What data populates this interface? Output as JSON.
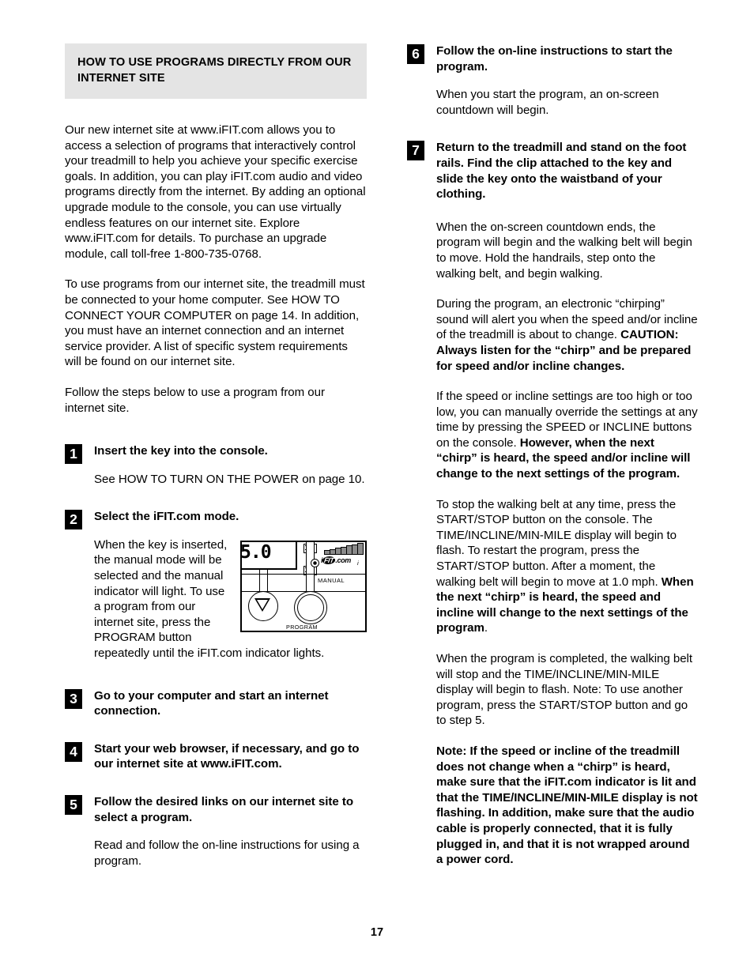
{
  "page": {
    "number": "17"
  },
  "section": {
    "heading": "HOW TO USE PROGRAMS DIRECTLY FROM OUR INTERNET SITE"
  },
  "left_column": {
    "intro_paragraphs": [
      "Our new internet site at www.iFIT.com allows you to access a selection of programs that interactively control your treadmill to help you achieve your specific exercise goals. In addition, you can play iFIT.com audio and video programs directly from the internet. By adding an optional upgrade module to the console, you can use virtually endless features on our internet site. Explore www.iFIT.com for details. To purchase an upgrade module, call toll-free 1-800-735-0768.",
      "To use programs from our internet site, the treadmill must be connected to your home computer. See HOW TO CONNECT YOUR COMPUTER on page 14. In addition, you must have an internet connection and an internet service provider. A list of specific system requirements will be found on our internet site.",
      "Follow the steps below to use a program from our internet site."
    ],
    "steps": [
      {
        "number": "1",
        "title": "Insert the key into the console.",
        "body": "See HOW TO TURN ON THE POWER on page 10."
      },
      {
        "number": "2",
        "title": "Select the iFIT.com mode.",
        "body": "When the key is inserted, the manual mode will be selected and the manual indicator will light. To use a program from our internet site, press the PROGRAM button repeatedly until the iFIT.com indicator lights."
      },
      {
        "number": "3",
        "title": "Go to your computer and start an internet connection.",
        "body": ""
      },
      {
        "number": "4",
        "title": "Start your web browser, if necessary, and go to our internet site at www.iFIT.com.",
        "body": ""
      },
      {
        "number": "5",
        "title": "Follow the desired links on our internet site to select a program.",
        "body": "Read and follow the on-line instructions for using a program."
      }
    ],
    "console_figure": {
      "display_value": "5.0",
      "manual_label": "MANUAL",
      "program_label": "PROGRAM",
      "ifit_logo": "iFIT.com",
      "indicator_label": "i"
    }
  },
  "right_column": {
    "steps": [
      {
        "number": "6",
        "title": "Follow the on-line instructions to start the program.",
        "body": "When you start the program, an on-screen countdown will begin."
      },
      {
        "number": "7",
        "title": "Return to the treadmill and stand on the foot rails. Find the clip attached to the key and slide the key onto the waistband of your clothing.",
        "body": ""
      }
    ],
    "paragraphs": [
      {
        "normal_1": "When the on-screen countdown ends, the program will begin and the walking belt will begin to move. Hold the handrails, step onto the walking belt, and begin walking.",
        "bold_1": "",
        "normal_2": ""
      },
      {
        "normal_1": "During the program, an electronic “chirping” sound will alert you when the speed and/or incline of the treadmill is about to change. ",
        "bold_1": "CAUTION: Always listen for the “chirp” and be prepared for speed and/or incline changes.",
        "normal_2": ""
      },
      {
        "normal_1": "If the speed or incline settings are too high or too low, you can manually override the settings at any time by pressing the SPEED or INCLINE buttons on the console. ",
        "bold_1": "However, when the next “chirp” is heard, the speed and/or incline will change to the next settings of the program.",
        "normal_2": ""
      },
      {
        "normal_1": "To stop the walking belt at any time, press the START/STOP button on the console. The TIME/INCLINE/MIN-MILE display will begin to flash. To restart the program, press the START/STOP button. After a moment, the walking belt will begin to move at 1.0 mph. ",
        "bold_1": "When the next “chirp” is heard, the speed and incline will change to the next settings of the program",
        "normal_2": "."
      },
      {
        "normal_1": "When the program is completed, the walking belt will stop and the TIME/INCLINE/MIN-MILE display will begin to flash. Note: To use another program, press the START/STOP button and go to step 5.",
        "bold_1": "",
        "normal_2": ""
      },
      {
        "normal_1": "",
        "bold_1": "Note: If the speed or incline of the treadmill does not change when a “chirp” is heard, make sure that the iFIT.com indicator is lit and that the TIME/INCLINE/MIN-MILE display is not flashing. In addition, make sure that the audio cable is properly connected, that it is fully plugged in, and that it is not wrapped around a power cord.",
        "normal_2": ""
      }
    ]
  },
  "colors": {
    "band_background": "#e4e4e4",
    "text": "#000000",
    "step_box": "#000000",
    "step_numeral": "#ffffff"
  }
}
